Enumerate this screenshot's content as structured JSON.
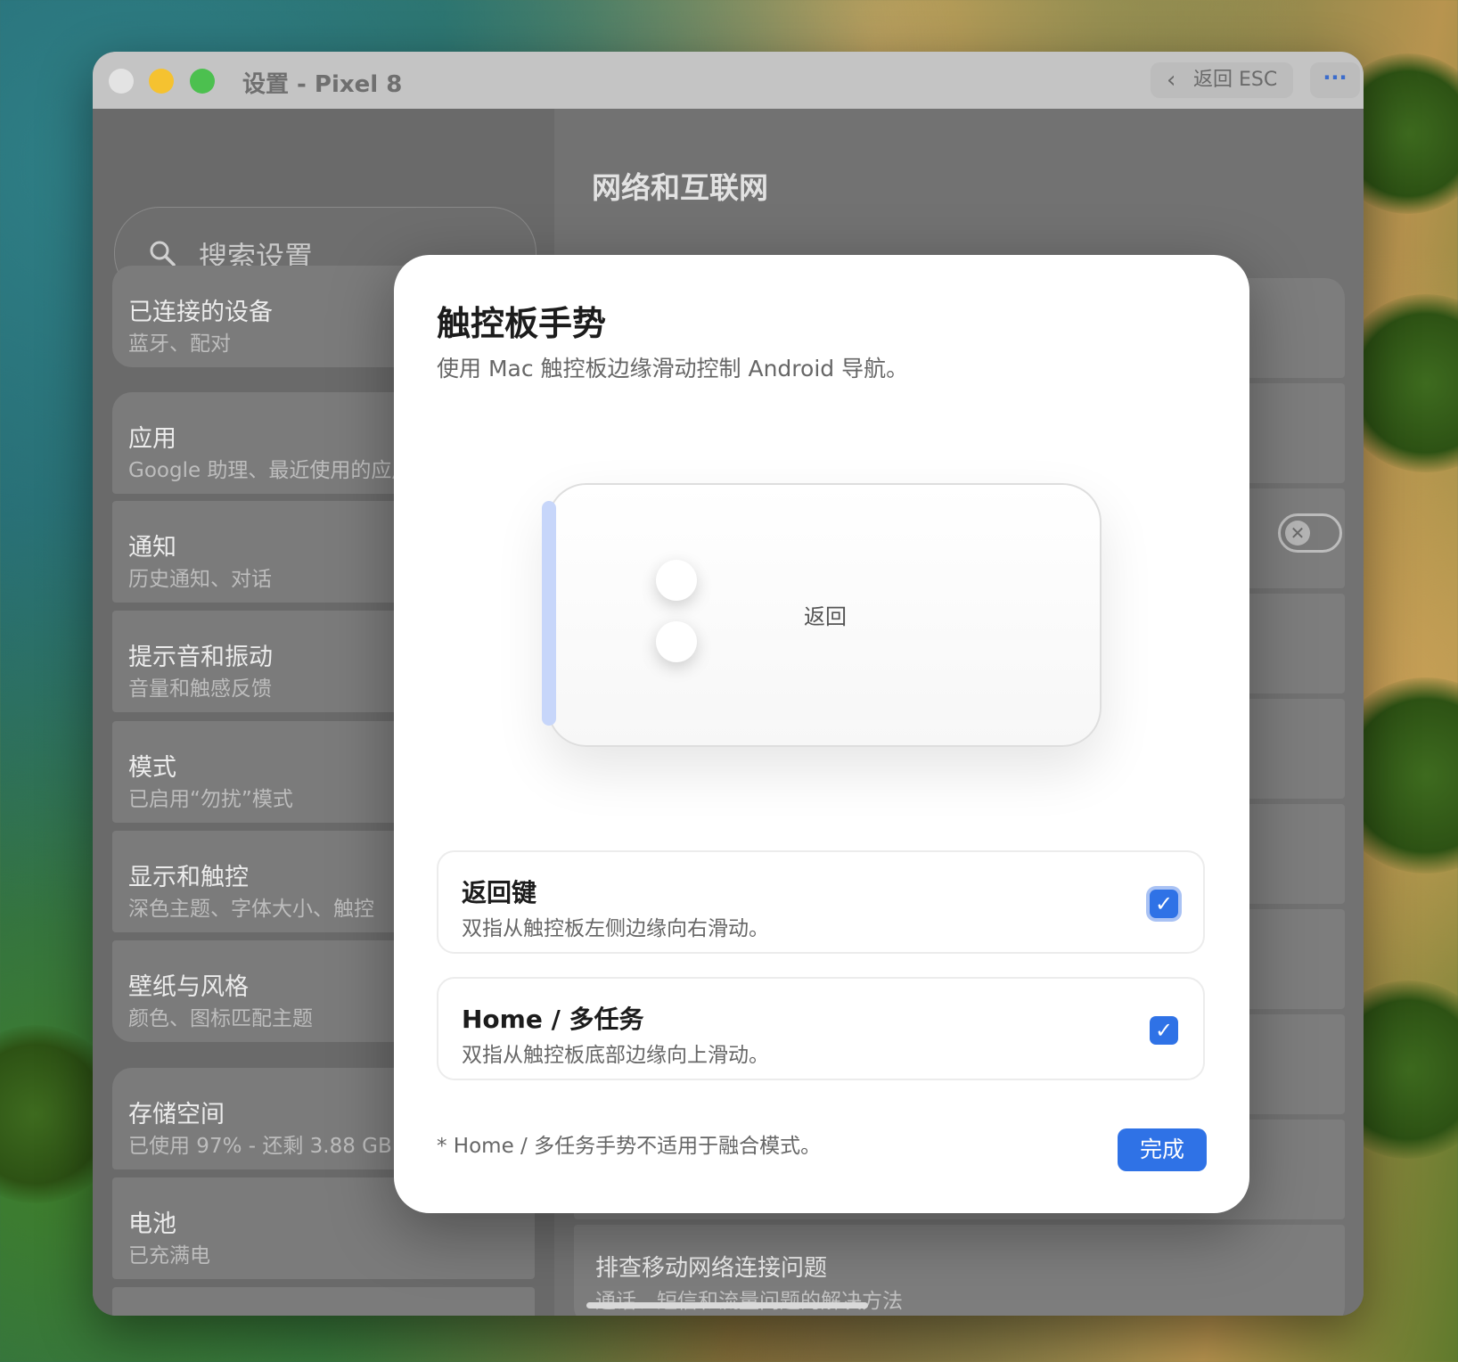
{
  "window": {
    "title": "设置 - Pixel 8",
    "back_label": "返回 ESC",
    "more_label": "···"
  },
  "sidebar": {
    "search_placeholder": "搜索设置",
    "items": [
      {
        "title": "已连接的设备",
        "subtitle": "蓝牙、配对"
      },
      {
        "title": "应用",
        "subtitle": "Google 助理、最近使用的应用、默认应用"
      },
      {
        "title": "通知",
        "subtitle": "历史通知、对话"
      },
      {
        "title": "提示音和振动",
        "subtitle": "音量和触感反馈"
      },
      {
        "title": "模式",
        "subtitle": "已启用“勿扰”模式"
      },
      {
        "title": "显示和触控",
        "subtitle": "深色主题、字体大小、触控"
      },
      {
        "title": "壁纸与风格",
        "subtitle": "颜色、图标匹配主题"
      },
      {
        "title": "存储空间",
        "subtitle": "已使用 97% - 还剩 3.88 GB"
      },
      {
        "title": "电池",
        "subtitle": "已充满电"
      }
    ]
  },
  "main": {
    "title": "网络和互联网",
    "last_card": {
      "title": "排查移动网络连接问题",
      "subtitle": "通话、短信和流量问题的解决方法"
    },
    "toggle_state": "off"
  },
  "dialog": {
    "title": "触控板手势",
    "subtitle": "使用 Mac 触控板边缘滑动控制 Android 导航。",
    "illustration_label": "返回",
    "options": [
      {
        "title": "返回键",
        "subtitle": "双指从触控板左侧边缘向右滑动。",
        "checked": true
      },
      {
        "title": "Home / 多任务",
        "subtitle": "双指从触控板底部边缘向上滑动。",
        "checked": true
      }
    ],
    "footnote": "* Home / 多任务手势不适用于融合模式。",
    "done_label": "完成"
  },
  "icons": {
    "search": "search-icon",
    "back": "chevron-left-icon",
    "check": "checkmark-icon",
    "toggle_off": "x-icon"
  },
  "colors": {
    "accent": "#2f72e6",
    "close": "#e3e3e3",
    "minimize": "#f5c230",
    "maximize": "#4cc04f"
  }
}
